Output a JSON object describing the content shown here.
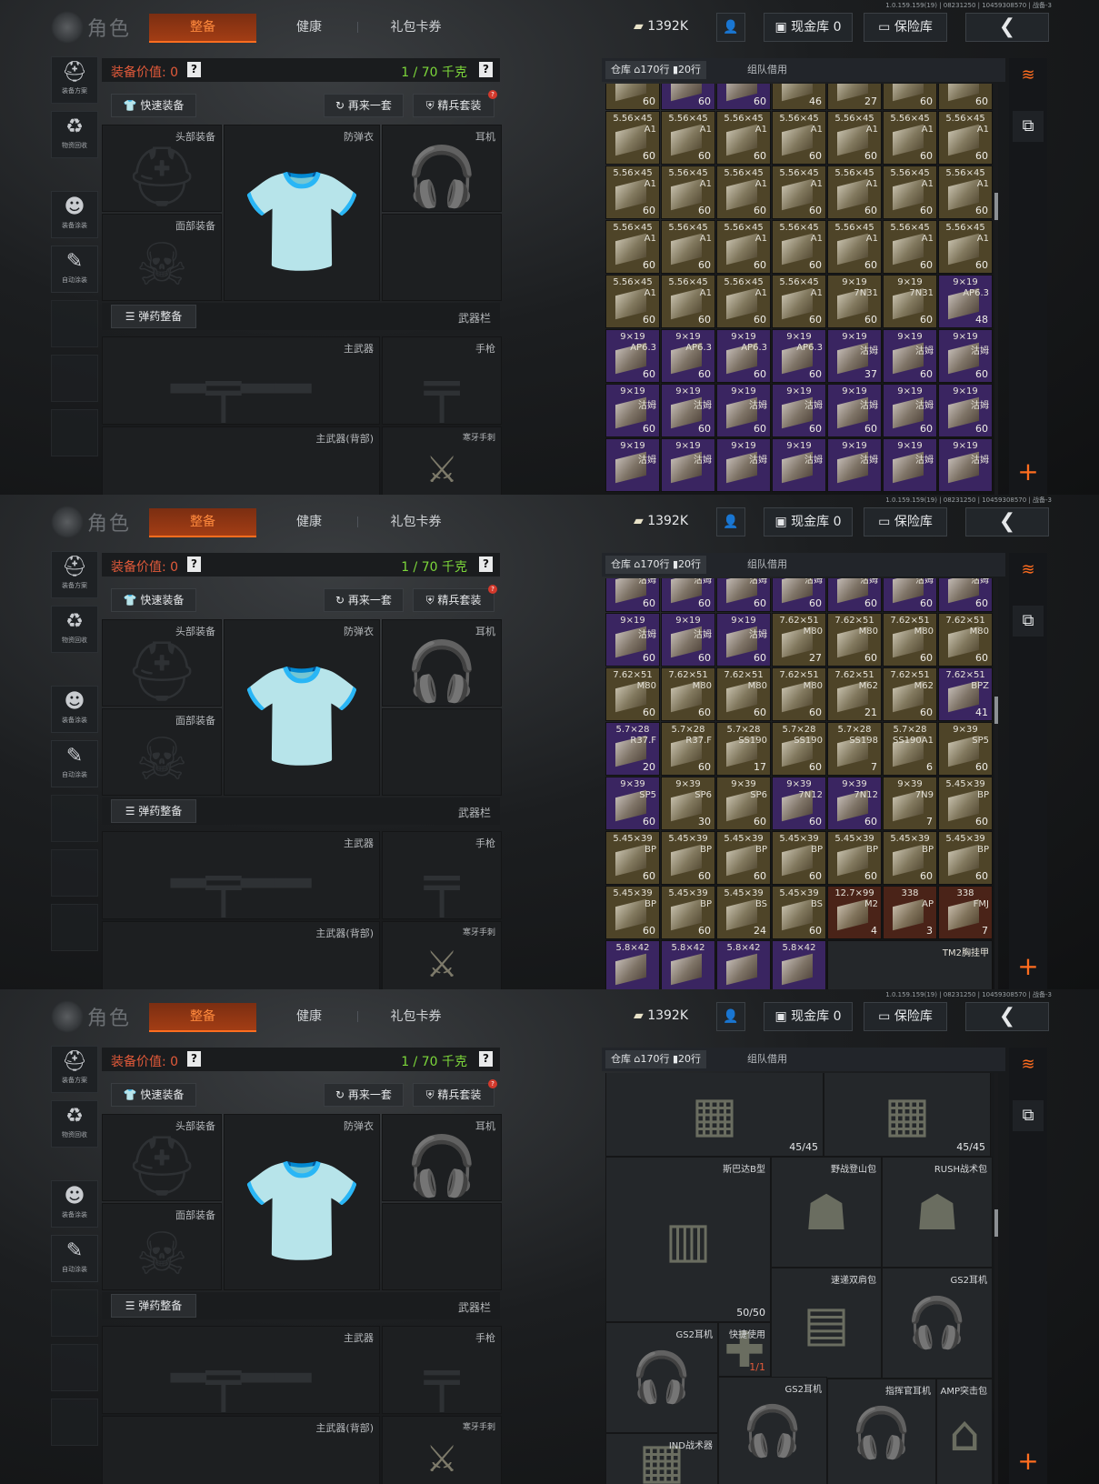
{
  "frames": [
    {
      "version": "1.0.159.159(19) | 08231250 | 10459308570 | 战备-3",
      "title": "角色",
      "tabs": [
        "整备",
        "健康",
        "礼包卡券"
      ],
      "top": {
        "coin": "1392K",
        "cash": "现金库 0",
        "safe": "保险库",
        "back": "❮"
      },
      "left_icons": [
        "装备方案",
        "物资回收",
        "装备涂装",
        "自动涂装"
      ],
      "equip_value": "装备价值: 0",
      "weight": "1 / 70 千克",
      "quick": "快速装备",
      "again": "再来一套",
      "elite": "精兵套装",
      "elite_badge": "?",
      "slots": {
        "head": "头部装备",
        "armor": "防弹衣",
        "ear": "耳机",
        "face": "面部装备",
        "weapon_bar": "武器栏",
        "ammo": "弹药整备",
        "primary": "主武器",
        "pistol": "手枪",
        "primary_back": "主武器(背部)",
        "melee": "寒牙手刺"
      },
      "warehouse": {
        "tab1": "仓库",
        "rows": "170行",
        "cols": "20行",
        "tab2": "组队借用"
      },
      "grid": [
        [
          [
            "",
            "",
            "60",
            "brown"
          ],
          [
            "",
            "",
            "60",
            "purple"
          ],
          [
            "",
            "",
            "60",
            "purple"
          ],
          [
            "",
            "",
            "46",
            "brown"
          ],
          [
            "",
            "",
            "27",
            "brown"
          ],
          [
            "",
            "",
            "60",
            "brown"
          ],
          [
            "",
            "",
            "60",
            "brown"
          ]
        ],
        [
          [
            "5.56×45",
            "A1",
            "60",
            "brown"
          ],
          [
            "5.56×45",
            "A1",
            "60",
            "brown"
          ],
          [
            "5.56×45",
            "A1",
            "60",
            "brown"
          ],
          [
            "5.56×45",
            "A1",
            "60",
            "brown"
          ],
          [
            "5.56×45",
            "A1",
            "60",
            "brown"
          ],
          [
            "5.56×45",
            "A1",
            "60",
            "brown"
          ],
          [
            "5.56×45",
            "A1",
            "60",
            "brown"
          ]
        ],
        [
          [
            "5.56×45",
            "A1",
            "60",
            "brown"
          ],
          [
            "5.56×45",
            "A1",
            "60",
            "brown"
          ],
          [
            "5.56×45",
            "A1",
            "60",
            "brown"
          ],
          [
            "5.56×45",
            "A1",
            "60",
            "brown"
          ],
          [
            "5.56×45",
            "A1",
            "60",
            "brown"
          ],
          [
            "5.56×45",
            "A1",
            "60",
            "brown"
          ],
          [
            "5.56×45",
            "A1",
            "60",
            "brown"
          ]
        ],
        [
          [
            "5.56×45",
            "A1",
            "60",
            "brown"
          ],
          [
            "5.56×45",
            "A1",
            "60",
            "brown"
          ],
          [
            "5.56×45",
            "A1",
            "60",
            "brown"
          ],
          [
            "5.56×45",
            "A1",
            "60",
            "brown"
          ],
          [
            "5.56×45",
            "A1",
            "60",
            "brown"
          ],
          [
            "5.56×45",
            "A1",
            "60",
            "brown"
          ],
          [
            "5.56×45",
            "A1",
            "60",
            "brown"
          ]
        ],
        [
          [
            "5.56×45",
            "A1",
            "60",
            "brown"
          ],
          [
            "5.56×45",
            "A1",
            "60",
            "brown"
          ],
          [
            "5.56×45",
            "A1",
            "60",
            "brown"
          ],
          [
            "5.56×45",
            "A1",
            "60",
            "brown"
          ],
          [
            "9×19",
            "7N31",
            "60",
            "brown"
          ],
          [
            "9×19",
            "7N31",
            "60",
            "brown"
          ],
          [
            "9×19",
            "AP6.3",
            "48",
            "purple"
          ]
        ],
        [
          [
            "9×19",
            "AP6.3",
            "60",
            "purple"
          ],
          [
            "9×19",
            "AP6.3",
            "60",
            "purple"
          ],
          [
            "9×19",
            "AP6.3",
            "60",
            "purple"
          ],
          [
            "9×19",
            "AP6.3",
            "60",
            "purple"
          ],
          [
            "9×19",
            "沽姆",
            "37",
            "purple"
          ],
          [
            "9×19",
            "沽姆",
            "60",
            "purple"
          ],
          [
            "9×19",
            "沽姆",
            "60",
            "purple"
          ]
        ],
        [
          [
            "9×19",
            "沽姆",
            "60",
            "purple"
          ],
          [
            "9×19",
            "沽姆",
            "60",
            "purple"
          ],
          [
            "9×19",
            "沽姆",
            "60",
            "purple"
          ],
          [
            "9×19",
            "沽姆",
            "60",
            "purple"
          ],
          [
            "9×19",
            "沽姆",
            "60",
            "purple"
          ],
          [
            "9×19",
            "沽姆",
            "60",
            "purple"
          ],
          [
            "9×19",
            "沽姆",
            "60",
            "purple"
          ]
        ],
        [
          [
            "9×19",
            "沽姆",
            "",
            "purple"
          ],
          [
            "9×19",
            "沽姆",
            "",
            "purple"
          ],
          [
            "9×19",
            "沽姆",
            "",
            "purple"
          ],
          [
            "9×19",
            "沽姆",
            "",
            "purple"
          ],
          [
            "9×19",
            "沽姆",
            "",
            "purple"
          ],
          [
            "9×19",
            "沽姆",
            "",
            "purple"
          ],
          [
            "9×19",
            "沽姆",
            "",
            "purple"
          ]
        ]
      ]
    },
    {
      "version": "1.0.159.159(19) | 08231250 | 10459308570 | 战备-3",
      "title": "角色",
      "tabs": [
        "整备",
        "健康",
        "礼包卡券"
      ],
      "top": {
        "coin": "1392K",
        "cash": "现金库 0",
        "safe": "保险库",
        "back": "❮"
      },
      "left_icons": [
        "装备方案",
        "物资回收",
        "装备涂装",
        "自动涂装"
      ],
      "equip_value": "装备价值: 0",
      "weight": "1 / 70 千克",
      "quick": "快速装备",
      "again": "再来一套",
      "elite": "精兵套装",
      "elite_badge": "?",
      "slots": {
        "head": "头部装备",
        "armor": "防弹衣",
        "ear": "耳机",
        "face": "面部装备",
        "weapon_bar": "武器栏",
        "ammo": "弹药整备",
        "primary": "主武器",
        "pistol": "手枪",
        "primary_back": "主武器(背部)",
        "melee": "寒牙手刺"
      },
      "warehouse": {
        "tab1": "仓库",
        "rows": "170行",
        "cols": "20行",
        "tab2": "组队借用"
      },
      "grid": [
        [
          [
            "9×19",
            "沽姆",
            "60",
            "purple"
          ],
          [
            "9×19",
            "沽姆",
            "60",
            "purple"
          ],
          [
            "9×19",
            "沽姆",
            "60",
            "purple"
          ],
          [
            "9×19",
            "沽姆",
            "60",
            "purple"
          ],
          [
            "9×19",
            "沽姆",
            "60",
            "purple"
          ],
          [
            "9×19",
            "沽姆",
            "60",
            "purple"
          ],
          [
            "9×19",
            "沽姆",
            "60",
            "purple"
          ]
        ],
        [
          [
            "9×19",
            "沽姆",
            "60",
            "purple"
          ],
          [
            "9×19",
            "沽姆",
            "60",
            "purple"
          ],
          [
            "9×19",
            "沽姆",
            "60",
            "purple"
          ],
          [
            "7.62×51",
            "M80",
            "27",
            "brown"
          ],
          [
            "7.62×51",
            "M80",
            "60",
            "brown"
          ],
          [
            "7.62×51",
            "M80",
            "60",
            "brown"
          ],
          [
            "7.62×51",
            "M80",
            "60",
            "brown"
          ]
        ],
        [
          [
            "7.62×51",
            "M80",
            "60",
            "brown"
          ],
          [
            "7.62×51",
            "M80",
            "60",
            "brown"
          ],
          [
            "7.62×51",
            "M80",
            "60",
            "brown"
          ],
          [
            "7.62×51",
            "M80",
            "60",
            "brown"
          ],
          [
            "7.62×51",
            "M62",
            "21",
            "brown"
          ],
          [
            "7.62×51",
            "M62",
            "60",
            "brown"
          ],
          [
            "7.62×51",
            "BPZ",
            "41",
            "purple"
          ]
        ],
        [
          [
            "5.7×28",
            "R37.F",
            "20",
            "purple"
          ],
          [
            "5.7×28",
            "R37.F",
            "60",
            "brown"
          ],
          [
            "5.7×28",
            "SS190",
            "17",
            "brown"
          ],
          [
            "5.7×28",
            "SS190",
            "60",
            "brown"
          ],
          [
            "5.7×28",
            "SS198",
            "7",
            "brown"
          ],
          [
            "5.7×28",
            "SS190A1",
            "6",
            "brown"
          ],
          [
            "9×39",
            "SP5",
            "60",
            "brown"
          ]
        ],
        [
          [
            "9×39",
            "SP5",
            "60",
            "purple"
          ],
          [
            "9×39",
            "SP6",
            "30",
            "brown"
          ],
          [
            "9×39",
            "SP6",
            "60",
            "brown"
          ],
          [
            "9×39",
            "7N12",
            "60",
            "purple"
          ],
          [
            "9×39",
            "7N12",
            "60",
            "purple"
          ],
          [
            "9×39",
            "7N9",
            "7",
            "brown"
          ],
          [
            "5.45×39",
            "BP",
            "60",
            "brown"
          ]
        ],
        [
          [
            "5.45×39",
            "BP",
            "60",
            "brown"
          ],
          [
            "5.45×39",
            "BP",
            "60",
            "brown"
          ],
          [
            "5.45×39",
            "BP",
            "60",
            "brown"
          ],
          [
            "5.45×39",
            "BP",
            "60",
            "brown"
          ],
          [
            "5.45×39",
            "BP",
            "60",
            "brown"
          ],
          [
            "5.45×39",
            "BP",
            "60",
            "brown"
          ],
          [
            "5.45×39",
            "BP",
            "60",
            "brown"
          ]
        ],
        [
          [
            "5.45×39",
            "BP",
            "60",
            "brown"
          ],
          [
            "5.45×39",
            "BP",
            "60",
            "brown"
          ],
          [
            "5.45×39",
            "BS",
            "24",
            "brown"
          ],
          [
            "5.45×39",
            "BS",
            "60",
            "brown"
          ],
          [
            "12.7×99",
            "M2",
            "4",
            "red"
          ],
          [
            "338",
            "AP",
            "3",
            "red"
          ],
          [
            "338",
            "FMJ",
            "7",
            "red"
          ]
        ],
        [
          [
            "5.8×42",
            "",
            "",
            "purple"
          ],
          [
            "5.8×42",
            "",
            "",
            "purple"
          ],
          [
            "5.8×42",
            "",
            "",
            "purple"
          ],
          [
            "5.8×42",
            "",
            "",
            "purple"
          ]
        ]
      ],
      "tm2_label": "TM2胸挂甲"
    },
    {
      "version": "1.0.159.159(19) | 08231250 | 10459308570 | 战备-3",
      "title": "角色",
      "tabs": [
        "整备",
        "健康",
        "礼包卡券"
      ],
      "top": {
        "coin": "1392K",
        "cash": "现金库 0",
        "safe": "保险库",
        "back": "❮"
      },
      "left_icons": [
        "装备方案",
        "物资回收",
        "装备涂装",
        "自动涂装"
      ],
      "equip_value": "装备价值: 0",
      "weight": "1 / 70 千克",
      "quick": "快速装备",
      "again": "再来一套",
      "elite": "精兵套装",
      "elite_badge": "?",
      "slots": {
        "head": "头部装备",
        "armor": "防弹衣",
        "ear": "耳机",
        "face": "面部装备",
        "weapon_bar": "武器栏",
        "ammo": "弹药整备",
        "primary": "主武器",
        "pistol": "手枪",
        "primary_back": "主武器(背部)",
        "melee": "寒牙手刺"
      },
      "warehouse": {
        "tab1": "仓库",
        "rows": "170行",
        "cols": "20行",
        "tab2": "组队借用"
      },
      "gear": {
        "vest1_qty": "45/45",
        "vest2_qty": "45/45",
        "spartan": "斯巴达B型",
        "spartan_qty": "50/50",
        "field_pack": "野战登山包",
        "rush_pack": "RUSH战术包",
        "sling": "速递双肩包",
        "gs2_a": "GS2耳机",
        "gs2_b": "GS2耳机",
        "gs2_c": "GS2耳机",
        "quick_use": "快捷使用",
        "quick_qty": "1/1",
        "ind": "IND战术器",
        "commander": "指挥官耳机",
        "amp": "AMP突击包"
      }
    }
  ]
}
